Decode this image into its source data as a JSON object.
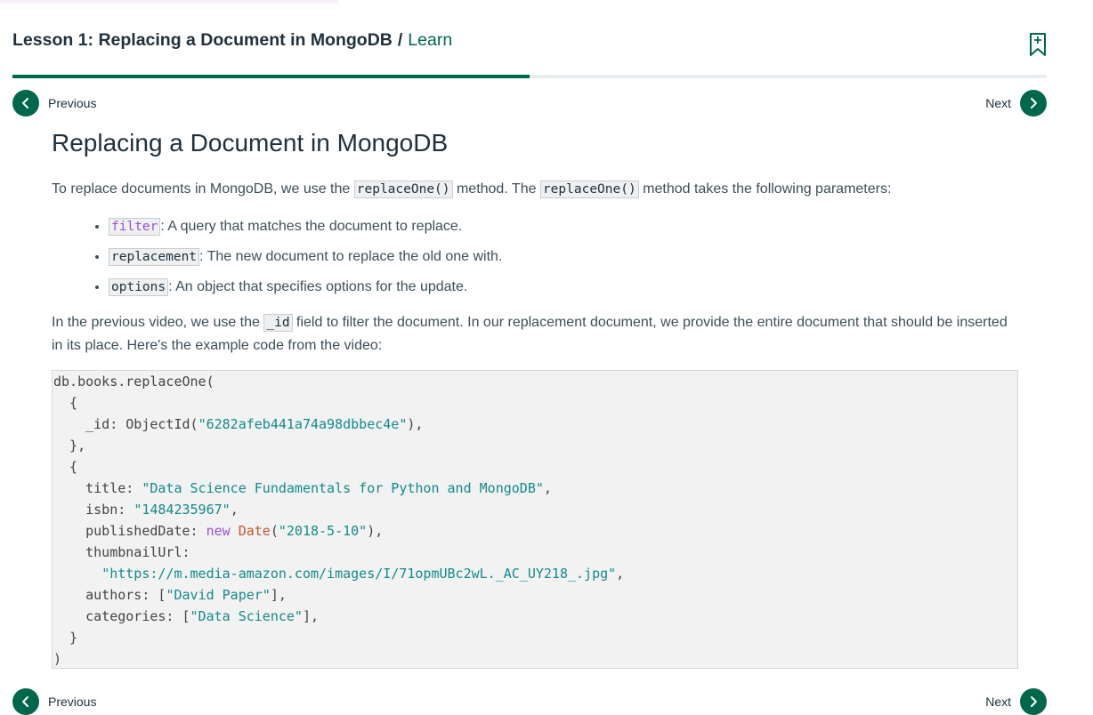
{
  "header": {
    "lesson_title": "Lesson 1: Replacing a Document in MongoDB",
    "separator": "/",
    "learn_link": "Learn"
  },
  "progress": {
    "fraction": 0.5
  },
  "nav": {
    "previous_label": "Previous",
    "next_label": "Next"
  },
  "article": {
    "title": "Replacing a Document in MongoDB",
    "intro": {
      "part1": "To replace documents in MongoDB, we use the ",
      "code1": "replaceOne()",
      "part2": " method. The ",
      "code2": "replaceOne()",
      "part3": " method takes the following parameters:"
    },
    "params": [
      {
        "name": "filter",
        "desc": ": A query that matches the document to replace."
      },
      {
        "name": "replacement",
        "desc": ": The new document to replace the old one with."
      },
      {
        "name": "options",
        "desc": ": An object that specifies options for the update."
      }
    ],
    "para2": {
      "part1": "In the previous video, we use the ",
      "code": "_id",
      "part2": " field to filter the document. In our replacement document, we provide the entire document that should be inserted in its place. Here's the example code from the video:"
    },
    "code": {
      "l1": "db.books.replaceOne(",
      "l2": "  {",
      "l3_key": "    _id: ObjectId(",
      "l3_str": "\"6282afeb441a74a98dbbec4e\"",
      "l3_end": "),",
      "l4": "  },",
      "l5": "  {",
      "l6_key": "    title: ",
      "l6_str": "\"Data Science Fundamentals for Python and MongoDB\"",
      "l6_end": ",",
      "l7_key": "    isbn: ",
      "l7_str": "\"1484235967\"",
      "l7_end": ",",
      "l8_key": "    publishedDate: ",
      "l8_new": "new",
      "l8_date": "Date",
      "l8_paren": "(",
      "l8_str": "\"2018-5-10\"",
      "l8_end": "),",
      "l9": "    thumbnailUrl:",
      "l10_indent": "      ",
      "l10_str": "\"https://m.media-amazon.com/images/I/71opmUBc2wL._AC_UY218_.jpg\"",
      "l10_end": ",",
      "l11_key": "    authors: [",
      "l11_str": "\"David Paper\"",
      "l11_end": "],",
      "l12_key": "    categories: [",
      "l12_str": "\"Data Science\"",
      "l12_end": "],",
      "l13": "  }",
      "l14": ")"
    }
  },
  "colors": {
    "brand_green": "#00684a",
    "string": "#128a8a",
    "keyword": "#9b4fd9",
    "function": "#c0552b"
  },
  "icons": [
    "bookmark-add-icon",
    "chevron-left-icon",
    "chevron-right-icon"
  ]
}
